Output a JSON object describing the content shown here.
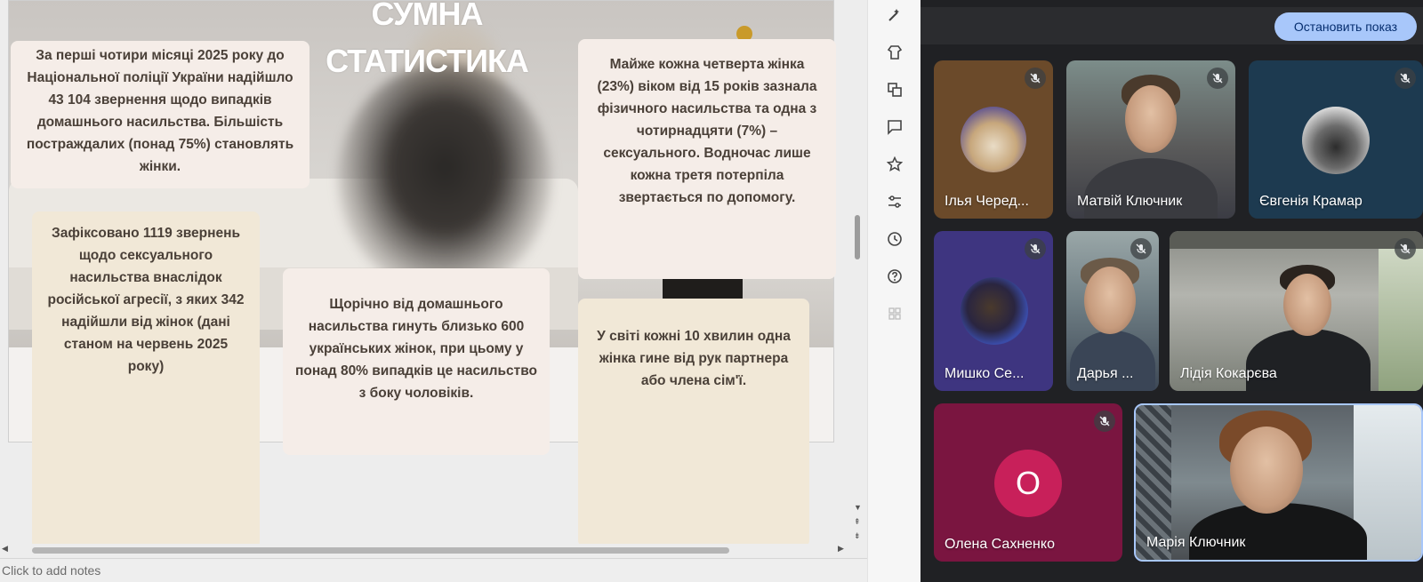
{
  "slide": {
    "title_line1": "СУМНА",
    "title_line2": "СТАТИСТИКА",
    "cards": [
      "За перші чотири місяці 2025 року до Національної поліції України надійшло 43 104 звернення щодо випадків домашнього насильства. Більшість постраждалих (понад 75%) становлять жінки.",
      "Зафіксовано 1119 звернень щодо сексуального насильства внаслідок російської агресії, з яких 342 надійшли від жінок (дані станом на червень 2025 року)",
      "Щорічно від домашнього насильства гинуть близько 600 українських жінок, при цьому у понад 80% випадків це насильство з боку чоловіків.",
      "Майже кожна четверта жінка (23%) віком від 15 років зазнала фізичного насильства та одна з чотирнадцяти (7%) – сексуального. Водночас лише кожна третя потерпіла звертається по допомогу.",
      "У світі кожні 10 хвилин одна жінка гине від рук партнера або члена сім'ї."
    ]
  },
  "notes": {
    "placeholder": "Click to add notes"
  },
  "toolbar": {
    "icons": [
      "magic-wand-icon",
      "theme-icon",
      "layout-icon",
      "comment-icon",
      "star-icon",
      "sliders-icon",
      "history-icon",
      "help-icon",
      "apps-icon"
    ]
  },
  "call": {
    "stop_button": "Остановить показ",
    "participants": [
      {
        "name": "Ілья Черед...",
        "muted": true
      },
      {
        "name": "Матвій Ключник",
        "muted": true
      },
      {
        "name": "Євгенія Крамар",
        "muted": true
      },
      {
        "name": "Мишко Се...",
        "muted": true
      },
      {
        "name": "Дарья ...",
        "muted": true
      },
      {
        "name": "Лідія Кокарєва",
        "muted": true
      },
      {
        "name": "Олена Сахненко",
        "muted": true,
        "initial": "О"
      },
      {
        "name": "Марія Ключник",
        "muted": false
      }
    ]
  },
  "colors": {
    "accent": "#a8c7fa",
    "call_background": "#202124",
    "card_pink": "#f5ede8",
    "card_beige": "#f1e8d7"
  }
}
